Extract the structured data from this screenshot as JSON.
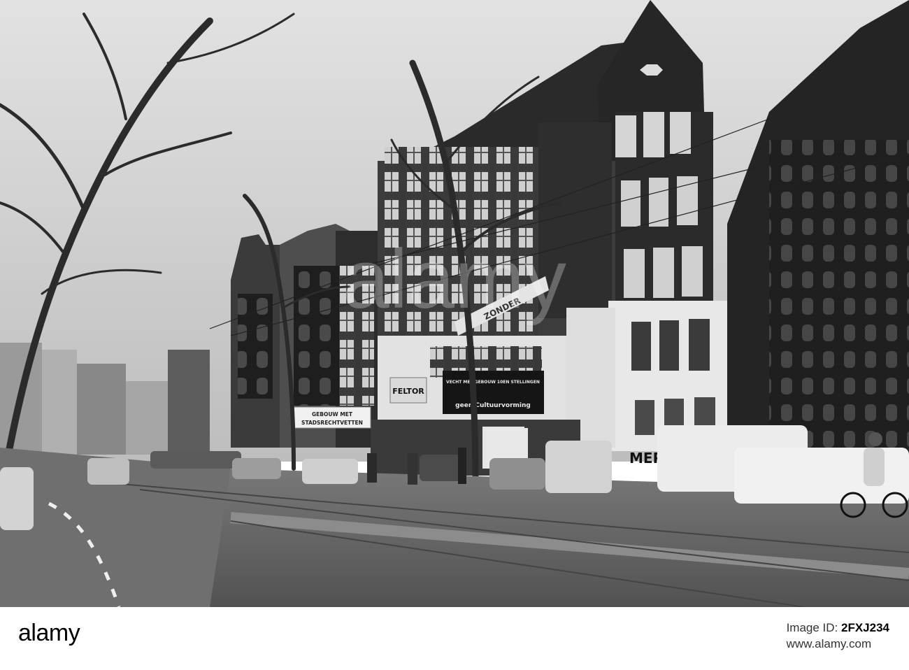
{
  "photo": {
    "banner_left": "GEBOUW MET",
    "banner_left_2": "STADSRECHTVETTEN",
    "banner_main_1": "VECHT MET GEBOUW 10EN STELLINGEN",
    "banner_main_2": "geen Cultuurvorming",
    "banner_sign": "FELTOR",
    "banner_diagonal": "ZONDER",
    "graffiti": "MEP",
    "watermark": "alamy",
    "colors": {
      "sky": "#c9c9c9",
      "road": "#6a6a6a",
      "facade_dark": "#2a2a2a",
      "facade_white": "#e6e6e6"
    }
  },
  "stock": {
    "logo_light": "alamy",
    "image_id_label": "Image ID:",
    "image_id": "2FXJ234",
    "url": "www.alamy.com"
  }
}
